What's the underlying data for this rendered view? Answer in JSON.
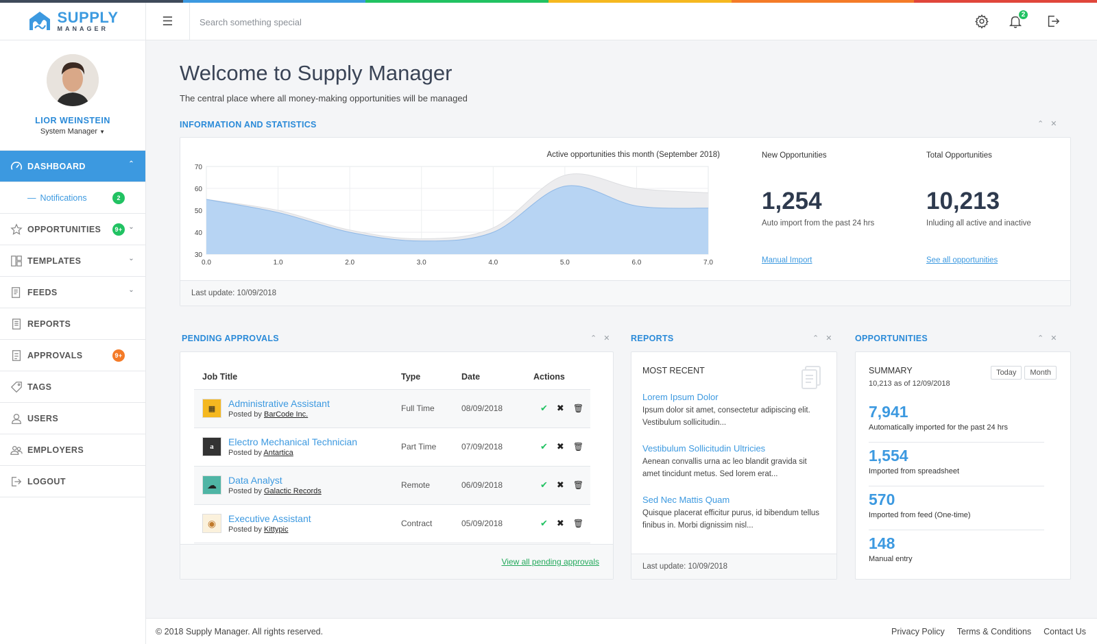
{
  "app": {
    "logo_title": "SUPPLY",
    "logo_sub": "MANAGER"
  },
  "colors": {
    "accent": "#3c99e0",
    "success": "#21c262",
    "warning": "#f47b28",
    "rainbow": [
      "#3f4a5a",
      "#3c99e0",
      "#21c262",
      "#f5b820",
      "#f47b28",
      "#e0463b"
    ]
  },
  "search": {
    "placeholder": "Search something special"
  },
  "topbar": {
    "icons": [
      "gear-icon",
      "bell-icon",
      "logout-icon"
    ],
    "notif_count": "2"
  },
  "user": {
    "name": "LIOR WEINSTEIN",
    "role": "System Manager"
  },
  "nav": {
    "dashboard": "DASHBOARD",
    "notifications": "Notifications",
    "notifications_badge": "2",
    "opportunities": "OPPORTUNITIES",
    "opportunities_badge": "9+",
    "templates": "TEMPLATES",
    "feeds": "FEEDS",
    "reports": "REPORTS",
    "approvals": "APPROVALS",
    "approvals_badge": "9+",
    "tags": "TAGS",
    "users": "USERS",
    "employers": "EMPLOYERS",
    "logout": "LOGOUT"
  },
  "page": {
    "title": "Welcome to Supply Manager",
    "subtitle": "The central place where all money-making opportunities will be managed"
  },
  "info": {
    "heading": "INFORMATION AND STATISTICS",
    "last_update": "Last update: 10/09/2018",
    "new_label": "New Opportunities",
    "new_value": "1,254",
    "new_desc": "Auto import from the past 24 hrs",
    "new_link": "Manual Import",
    "total_label": "Total Opportunities",
    "total_value": "10,213",
    "total_desc": "Inluding all active and inactive",
    "total_link": "See all opportunities"
  },
  "chart_data": {
    "type": "area",
    "title": "Active opportunities this month (September 2018)",
    "xlabel": "",
    "ylabel": "",
    "xlim": [
      0,
      7
    ],
    "ylim": [
      30,
      70
    ],
    "x_ticks": [
      "0.0",
      "1.0",
      "2.0",
      "3.0",
      "4.0",
      "5.0",
      "6.0",
      "7.0"
    ],
    "y_ticks": [
      "30",
      "40",
      "50",
      "60",
      "70"
    ],
    "grid": true,
    "series": [
      {
        "x": [
          0,
          1,
          2,
          3,
          4,
          5,
          6,
          7
        ],
        "values": [
          55,
          50,
          41,
          37,
          42,
          66,
          60,
          58
        ],
        "color": "#ececee"
      },
      {
        "x": [
          0,
          1,
          2,
          3,
          4,
          5,
          6,
          7
        ],
        "values": [
          55,
          49,
          40,
          36,
          40,
          61,
          52,
          51
        ],
        "color": "#b7d4f3"
      }
    ]
  },
  "approvals": {
    "heading": "PENDING APPROVALS",
    "columns": [
      "Job Title",
      "Type",
      "Date",
      "Actions"
    ],
    "rows": [
      {
        "title": "Administrative Assistant",
        "posted_by": "Posted by",
        "company": "BarCode Inc.",
        "type": "Full Time",
        "date": "08/09/2018"
      },
      {
        "title": "Electro Mechanical Technician",
        "posted_by": "Posted by",
        "company": "Antartica",
        "type": "Part Time",
        "date": "07/09/2018"
      },
      {
        "title": "Data Analyst",
        "posted_by": "Posted by",
        "company": "Galactic Records",
        "type": "Remote",
        "date": "06/09/2018"
      },
      {
        "title": "Executive Assistant",
        "posted_by": "Posted by",
        "company": "Kittypic",
        "type": "Contract",
        "date": "05/09/2018"
      }
    ],
    "view_all": "View all pending approvals"
  },
  "reports": {
    "heading": "REPORTS",
    "sub": "MOST RECENT",
    "items": [
      {
        "title": "Lorem Ipsum Dolor",
        "text": "Ipsum dolor sit amet, consectetur adipiscing elit. Vestibulum sollicitudin..."
      },
      {
        "title": "Vestibulum Sollicitudin Ultricies",
        "text": "Aenean convallis urna ac leo blandit gravida sit amet tincidunt metus. Sed lorem erat..."
      },
      {
        "title": "Sed Nec Mattis Quam",
        "text": "Quisque placerat efficitur purus, id bibendum tellus finibus in. Morbi dignissim nisl..."
      }
    ],
    "last_update": "Last update: 10/09/2018"
  },
  "opps": {
    "heading": "OPPORTUNITIES",
    "summary": "SUMMARY",
    "summary_sub": "10,213 as of 12/09/2018",
    "today": "Today",
    "month": "Month",
    "rows": [
      {
        "value": "7,941",
        "desc": "Automatically imported for the past 24 hrs"
      },
      {
        "value": "1,554",
        "desc": "Imported from spreadsheet"
      },
      {
        "value": "570",
        "desc": "Imported from feed (One-time)"
      },
      {
        "value": "148",
        "desc": "Manual entry"
      }
    ]
  },
  "footer": {
    "copyright": "© 2018 Supply Manager. All rights reserved.",
    "privacy": "Privacy Policy",
    "terms": "Terms & Conditions",
    "contact": "Contact Us"
  }
}
